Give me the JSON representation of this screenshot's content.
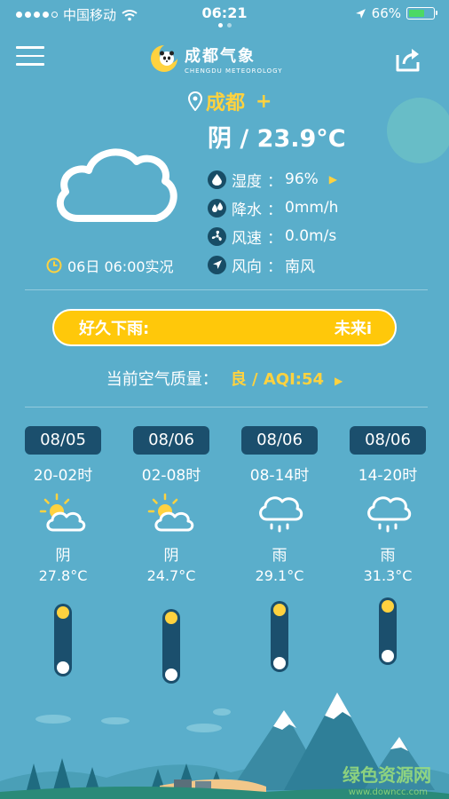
{
  "status": {
    "carrier": "中国移动",
    "time": "06:21",
    "battery": "66%",
    "battery_level": 0.66
  },
  "header": {
    "logo_cn": "成都气象",
    "logo_en": "CHENGDU METEOROLOGY"
  },
  "location": {
    "city": "成都",
    "add": "+"
  },
  "current": {
    "summary": "阴 / 23.9°C",
    "observation_time": "06日 06:00实况",
    "details": [
      {
        "icon": "humidity-icon",
        "label": "湿度",
        "colon": "：",
        "value": "96%"
      },
      {
        "icon": "precipitation-icon",
        "label": "降水",
        "colon": "：",
        "value": "0mm/h"
      },
      {
        "icon": "wind-speed-icon",
        "label": "风速",
        "colon": "：",
        "value": "0.0m/s"
      },
      {
        "icon": "wind-direction-icon",
        "label": "风向",
        "colon": "：",
        "value": "南风"
      }
    ]
  },
  "banner": {
    "left": "好久下雨:",
    "right": "未来i"
  },
  "aqi": {
    "label": "当前空气质量：",
    "value": "良 / AQI:54"
  },
  "forecast": [
    {
      "date": "08/05",
      "period": "20-02时",
      "icon": "partly-cloudy-icon",
      "condition": "阴",
      "temp": "27.8°C"
    },
    {
      "date": "08/06",
      "period": "02-08时",
      "icon": "partly-cloudy-icon",
      "condition": "阴",
      "temp": "24.7°C"
    },
    {
      "date": "08/06",
      "period": "08-14时",
      "icon": "rain-cloud-icon",
      "condition": "雨",
      "temp": "29.1°C"
    },
    {
      "date": "08/06",
      "period": "14-20时",
      "icon": "rain-cloud-icon",
      "condition": "雨",
      "temp": "31.3°C"
    }
  ],
  "watermark": {
    "text": "绿色资源网",
    "sub": "www.downcc.com"
  },
  "colors": {
    "background": "#5aaecb",
    "accent": "#ffd23f",
    "banner": "#ffc80a",
    "dark": "#1b4f6d"
  }
}
